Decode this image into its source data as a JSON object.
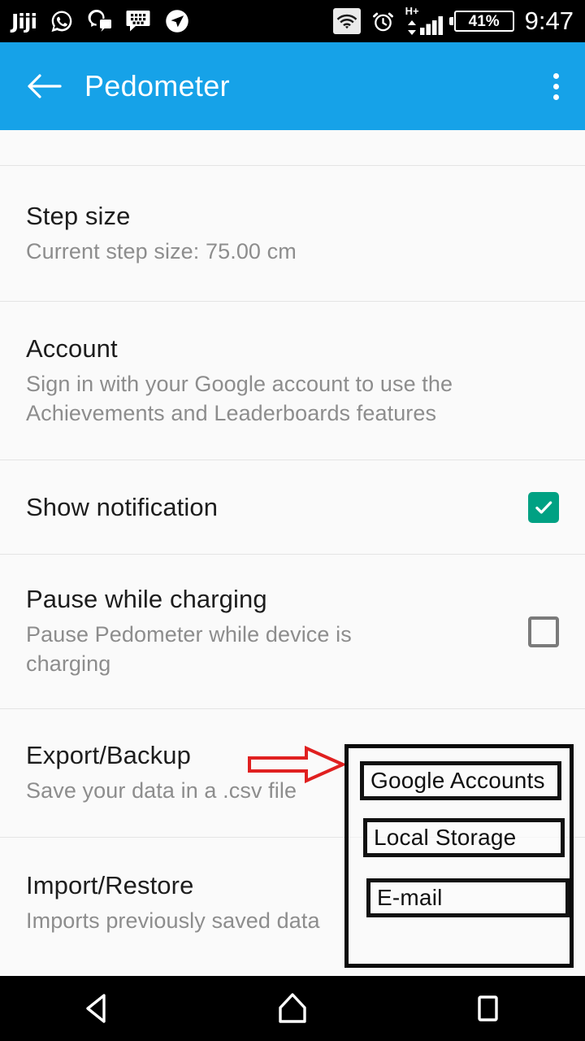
{
  "statusbar": {
    "left_icons": [
      {
        "name": "jiji-app-icon",
        "glyph": "Jiji"
      },
      {
        "name": "whatsapp-icon",
        "glyph": "whatsapp"
      },
      {
        "name": "messenger-icon",
        "glyph": "messenger"
      },
      {
        "name": "bbm-icon",
        "glyph": "bbm"
      },
      {
        "name": "navigation-icon",
        "glyph": "navigation"
      }
    ],
    "wifi_label": "wifi-icon",
    "alarm_label": "alarm-icon",
    "network_type": "H+",
    "signal_label": "signal-bars-icon",
    "battery_percent": "41%",
    "time": "9:47"
  },
  "appbar": {
    "back_label": "back-arrow",
    "title": "Pedometer",
    "overflow_label": "more-options"
  },
  "settings": {
    "rows": [
      {
        "id": "clipped-row",
        "title": "",
        "subtitle": "",
        "widget": "none"
      },
      {
        "id": "step-size",
        "title": "Step size",
        "subtitle": "Current step size: 75.00 cm",
        "widget": "none"
      },
      {
        "id": "account",
        "title": "Account",
        "subtitle": "Sign in with your Google account to use the Achievements and Leaderboards features",
        "widget": "none"
      },
      {
        "id": "show-notification",
        "title": "Show notification",
        "subtitle": "",
        "widget": "checkbox-checked"
      },
      {
        "id": "pause-while-charging",
        "title": "Pause while charging",
        "subtitle": "Pause Pedometer while device is charging",
        "widget": "checkbox-unchecked"
      },
      {
        "id": "export-backup",
        "title": "Export/Backup",
        "subtitle": "Save your data in a .csv file",
        "widget": "none"
      },
      {
        "id": "import-restore",
        "title": "Import/Restore",
        "subtitle": "Imports previously saved data",
        "widget": "none"
      }
    ]
  },
  "popup_menu": {
    "items": [
      {
        "label": "Google Accounts"
      },
      {
        "label": "Local Storage"
      },
      {
        "label": "E-mail"
      }
    ]
  },
  "annotation": {
    "arrow_name": "red-pointer-arrow",
    "arrow_color": "#e02020"
  },
  "navbar": {
    "back_label": "back-nav",
    "home_label": "home-nav",
    "recents_label": "recents-nav"
  },
  "colors": {
    "appbar_blue": "#16a2e8",
    "checkbox_green": "#00a183",
    "background": "#fafafa",
    "annotation_red": "#e02020"
  }
}
